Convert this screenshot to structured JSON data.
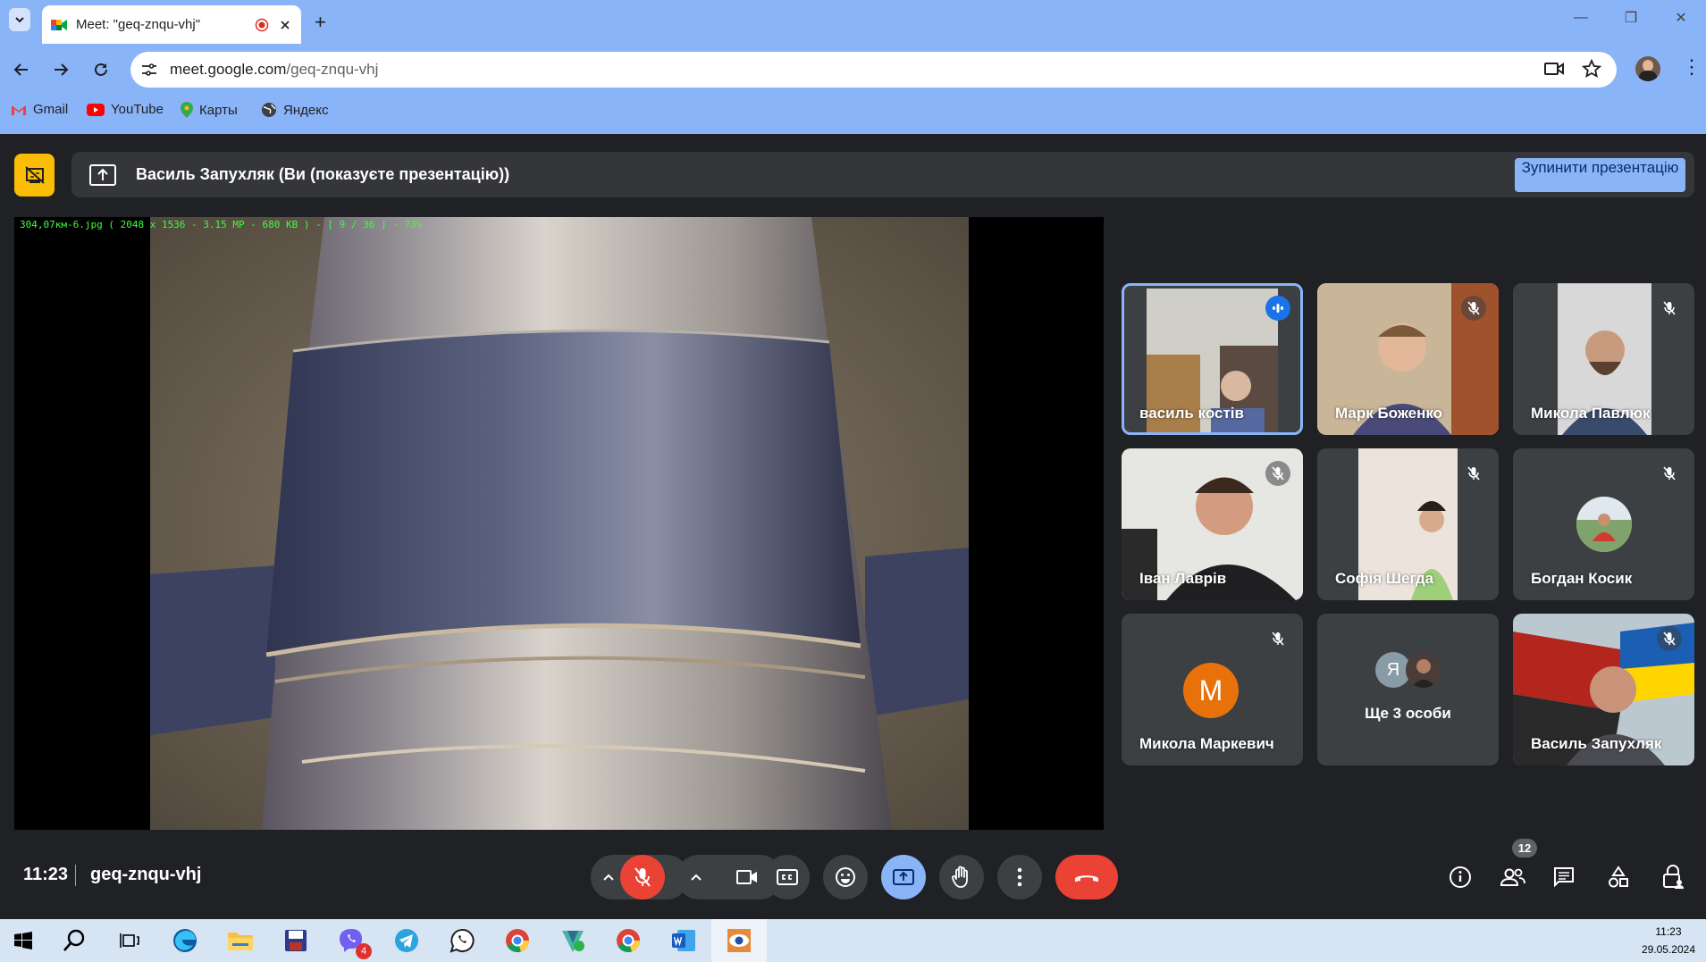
{
  "browser": {
    "tab_title": "Meet: \"geq-znqu-vhj\"",
    "url_host": "meet.google.com",
    "url_path": "/geq-znqu-vhj",
    "new_tab": "+",
    "bookmarks": [
      {
        "label": "Gmail",
        "icon": "gmail-icon"
      },
      {
        "label": "YouTube",
        "icon": "youtube-icon"
      },
      {
        "label": "Карты",
        "icon": "maps-icon"
      },
      {
        "label": "Яндекс",
        "icon": "globe-icon"
      }
    ]
  },
  "meet": {
    "presenting_text": "Василь Запухляк (Ви (показуєте презентацію))",
    "stop_button": "Зупинити презентацію",
    "shared_image_info": "304,07км-6.jpg  ( 2048 x 1536 - 3.15 MP - 680 KB ) - [ 9 / 36 ] - 73%",
    "participants": [
      {
        "name": "василь костів",
        "active": true,
        "speaking": true
      },
      {
        "name": "Марк Боженко",
        "muted": true
      },
      {
        "name": "Микола Павлюк",
        "muted": true
      },
      {
        "name": "Іван Лаврів",
        "muted": true
      },
      {
        "name": "Софія Шегда",
        "muted": true
      },
      {
        "name": "Богдан Косик",
        "muted": true
      },
      {
        "name": "Микола Маркевич",
        "muted": true,
        "initial": "M"
      },
      {
        "name": "Ще 3 особи",
        "initial": "Я"
      },
      {
        "name": "Василь Запухляк",
        "muted": true
      }
    ],
    "time": "11:23",
    "meeting_code": "geq-znqu-vhj",
    "participant_count": "12",
    "colors": {
      "accent": "#8ab4f8",
      "end_call": "#ea4335",
      "bg": "#202124",
      "tile": "#3c4043"
    }
  },
  "taskbar": {
    "time": "11:23",
    "date": "29.05.2024",
    "viber_badge": "4"
  }
}
